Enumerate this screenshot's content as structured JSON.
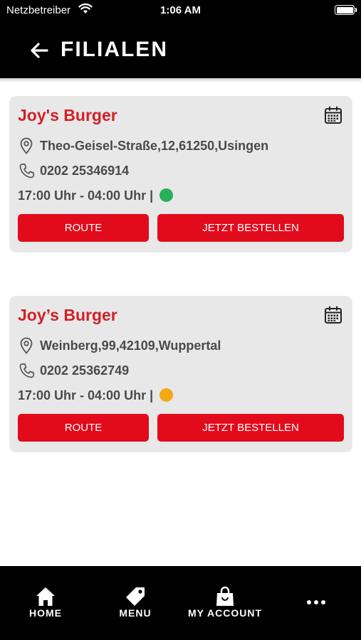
{
  "status_bar": {
    "carrier": "Netzbetreiber",
    "time": "1:06 AM",
    "battery_level": 1.0
  },
  "header": {
    "title": "FILIALEN"
  },
  "branches": [
    {
      "name": "Joy's Burger",
      "address": "Theo-Geisel-Straße,12,61250,Usingen",
      "phone": "0202 25346914",
      "hours": "17:00 Uhr - 04:00 Uhr |",
      "status_color": "#28b05a",
      "route_label": "ROUTE",
      "order_label": "JETZT BESTELLEN"
    },
    {
      "name": "Joy’s Burger",
      "address": "Weinberg,99,42109,Wuppertal",
      "phone": "0202 25362749",
      "hours": "17:00 Uhr - 04:00 Uhr |",
      "status_color": "#f4a814",
      "route_label": "ROUTE",
      "order_label": "JETZT BESTELLEN"
    }
  ],
  "bottom_nav": {
    "items": [
      {
        "label": "HOME",
        "icon": "home-icon"
      },
      {
        "label": "MENU",
        "icon": "tag-icon"
      },
      {
        "label": "MY ACCOUNT",
        "icon": "shopping-bag-icon"
      },
      {
        "label": "",
        "icon": "more-icon"
      }
    ]
  },
  "colors": {
    "brand_red": "#d21f26",
    "button_red": "#e20b1c",
    "card_bg": "#e8e8e8"
  }
}
